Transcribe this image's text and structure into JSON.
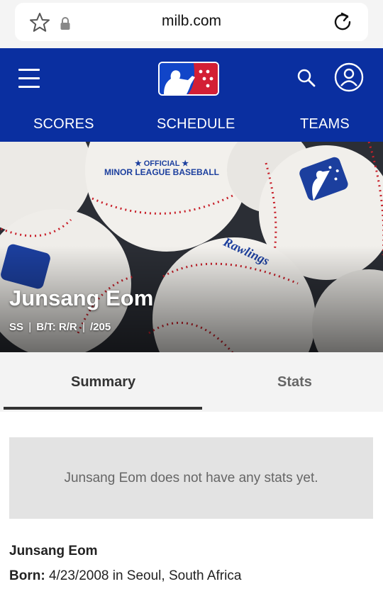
{
  "browser": {
    "url": "milb.com"
  },
  "nav": {
    "items": [
      "SCORES",
      "SCHEDULE",
      "TEAMS"
    ]
  },
  "hero": {
    "ball_text_1": "★ OFFICIAL ★",
    "ball_text_2": "MINOR LEAGUE BASEBALL",
    "ball_text_3": "Rawlings",
    "player_name": "Junsang Eom",
    "position": "SS",
    "bats_throws": "B/T: R/R",
    "height_weight": "/205"
  },
  "tabs": {
    "summary": "Summary",
    "stats": "Stats",
    "active": "Summary"
  },
  "notice": {
    "text": "Junsang Eom does not have any stats yet."
  },
  "bio": {
    "name": "Junsang Eom",
    "born_label": "Born:",
    "born_value": "4/23/2008 in Seoul, South Africa"
  },
  "icons": {
    "favorite": "star-icon",
    "secure": "lock-icon",
    "reload": "reload-icon",
    "menu": "hamburger-menu-icon",
    "search": "search-icon",
    "account": "account-icon"
  },
  "colors": {
    "brand_blue": "#0a2fa0",
    "logo_red": "#d31f35",
    "stitch_red": "#c8202a"
  }
}
